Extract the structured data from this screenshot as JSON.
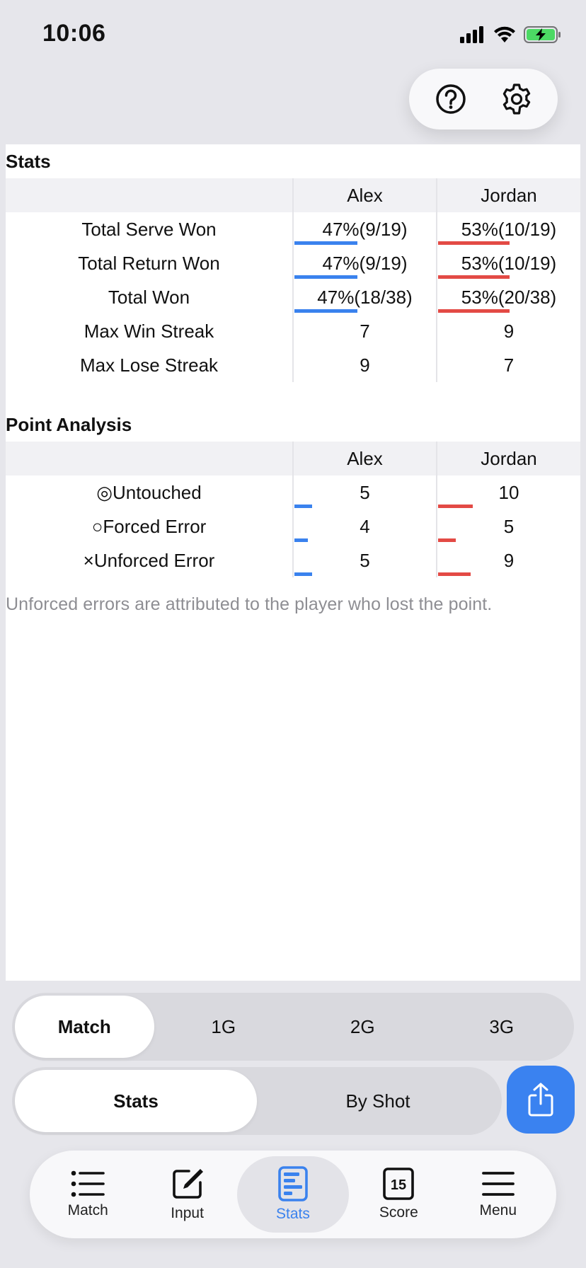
{
  "status": {
    "time": "10:06"
  },
  "stats": {
    "title": "Stats",
    "players": [
      "Alex",
      "Jordan"
    ],
    "rows": [
      {
        "label": "Total Serve Won",
        "p1": "47%(9/19)",
        "p2": "53%(10/19)",
        "p1_frac": 0.47,
        "p2_frac": 0.53
      },
      {
        "label": "Total Return Won",
        "p1": "47%(9/19)",
        "p2": "53%(10/19)",
        "p1_frac": 0.47,
        "p2_frac": 0.53
      },
      {
        "label": "Total Won",
        "p1": "47%(18/38)",
        "p2": "53%(20/38)",
        "p1_frac": 0.47,
        "p2_frac": 0.53
      },
      {
        "label": "Max Win Streak",
        "p1": "7",
        "p2": "9"
      },
      {
        "label": "Max Lose Streak",
        "p1": "9",
        "p2": "7"
      }
    ]
  },
  "analysis": {
    "title": "Point Analysis",
    "players": [
      "Alex",
      "Jordan"
    ],
    "rows": [
      {
        "label": "◎Untouched",
        "p1": "5",
        "p2": "10",
        "p1_frac": 0.13,
        "p2_frac": 0.26
      },
      {
        "label": "○Forced Error",
        "p1": "4",
        "p2": "5",
        "p1_frac": 0.1,
        "p2_frac": 0.13
      },
      {
        "label": "×Unforced Error",
        "p1": "5",
        "p2": "9",
        "p1_frac": 0.13,
        "p2_frac": 0.24
      }
    ],
    "note": "Unforced errors are attributed to the player who lost the point."
  },
  "period_segments": [
    "Match",
    "1G",
    "2G",
    "3G"
  ],
  "period_selected": "Match",
  "view_segments": [
    "Stats",
    "By Shot"
  ],
  "view_selected": "Stats",
  "tabs": [
    {
      "label": "Match",
      "icon": "list-icon"
    },
    {
      "label": "Input",
      "icon": "edit-icon"
    },
    {
      "label": "Stats",
      "icon": "stats-icon",
      "active": true
    },
    {
      "label": "Score",
      "icon": "score-icon"
    },
    {
      "label": "Menu",
      "icon": "menu-icon"
    }
  ],
  "score_icon_number": "15",
  "colors": {
    "accent": "#3a82ee",
    "player1": "#3a82ee",
    "player2": "#e34a45"
  }
}
